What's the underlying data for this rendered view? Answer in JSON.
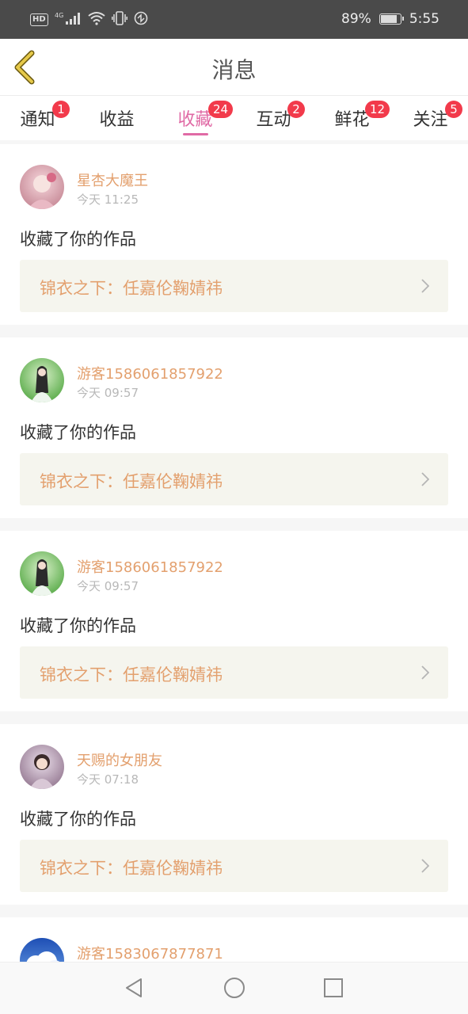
{
  "status_bar": {
    "network_badge": "HD",
    "network_type": "4G",
    "battery_percent_text": "89%",
    "battery_level": 0.89,
    "time": "5:55",
    "icons": [
      "hd-icon",
      "signal-icon",
      "wifi-icon",
      "vibrate-icon",
      "data-saver-icon",
      "battery-icon"
    ]
  },
  "header": {
    "title": "消息",
    "back_icon": "chevron-left-icon"
  },
  "tabs": [
    {
      "label": "通知",
      "badge": "1",
      "active": false
    },
    {
      "label": "收益",
      "badge": "",
      "active": false
    },
    {
      "label": "收藏",
      "badge": "24",
      "active": true
    },
    {
      "label": "互动",
      "badge": "2",
      "active": false
    },
    {
      "label": "鲜花",
      "badge": "12",
      "active": false
    },
    {
      "label": "关注",
      "badge": "5",
      "active": false
    }
  ],
  "colors": {
    "accent_pink": "#e06aa5",
    "badge_red": "#f23a4b",
    "name_orange": "#e3a06e",
    "work_box_bg": "#f5f5ee"
  },
  "messages": [
    {
      "name": "星杏大魔王",
      "time": "今天 11:25",
      "action": "收藏了你的作品",
      "work": "锦衣之下：任嘉伦鞠婧祎",
      "avatar": "avatar-pink-girl"
    },
    {
      "name": "游客1586061857922",
      "time": "今天 09:57",
      "action": "收藏了你的作品",
      "work": "锦衣之下：任嘉伦鞠婧祎",
      "avatar": "avatar-green-girl"
    },
    {
      "name": "游客1586061857922",
      "time": "今天 09:57",
      "action": "收藏了你的作品",
      "work": "锦衣之下：任嘉伦鞠婧祎",
      "avatar": "avatar-green-girl"
    },
    {
      "name": "天赐的女朋友",
      "time": "今天 07:18",
      "action": "收藏了你的作品",
      "work": "锦衣之下：任嘉伦鞠婧祎",
      "avatar": "avatar-purple-girl"
    },
    {
      "name": "游客1583067877871",
      "time": "",
      "action": "",
      "work": "",
      "avatar": "avatar-blue-sky"
    }
  ],
  "nav_bar": {
    "icons": [
      "back-triangle-icon",
      "home-circle-icon",
      "recents-square-icon"
    ]
  }
}
